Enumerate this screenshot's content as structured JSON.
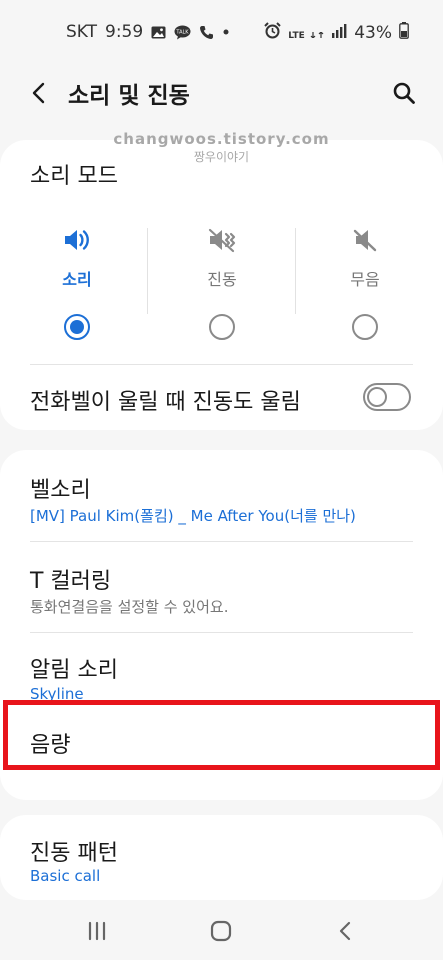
{
  "status_bar": {
    "carrier": "SKT",
    "time": "9:59",
    "left_icons": [
      "gallery-icon",
      "kakaotalk-icon",
      "phone-icon",
      "dot-icon"
    ],
    "right_icons": [
      "alarm-icon",
      "lte-icon",
      "signal-icon",
      "battery-icon"
    ],
    "lte_label": "LTE",
    "battery": "43%"
  },
  "app_bar": {
    "title": "소리 및 진동"
  },
  "watermark": {
    "line1": "changwoos.tistory.com",
    "line2": "짱우이야기"
  },
  "sound_mode": {
    "title": "소리 모드",
    "options": [
      {
        "label": "소리",
        "icon": "speaker-icon",
        "selected": true
      },
      {
        "label": "진동",
        "icon": "vibrate-icon",
        "selected": false
      },
      {
        "label": "무음",
        "icon": "mute-icon",
        "selected": false
      }
    ],
    "vibrate_when_ringing": {
      "label": "전화벨이 울릴 때 진동도 울림",
      "enabled": false
    }
  },
  "list": [
    {
      "title": "벨소리",
      "subtitle": "[MV] Paul Kim(폴킴) _ Me After You(너를 만나)"
    },
    {
      "title": "T 컬러링",
      "subtitle": "통화연결음을 설정할 수 있어요."
    },
    {
      "title": "알림 소리",
      "subtitle": "Skyline"
    },
    {
      "title": "음량",
      "subtitle": ""
    }
  ],
  "vibration_pattern": {
    "title": "진동 패턴",
    "subtitle": "Basic call"
  },
  "colors": {
    "accent": "#1c6fd6",
    "highlight": "#e8141b",
    "background": "#f6f6f6"
  },
  "nav_bar": {
    "buttons": [
      "recents-icon",
      "home-icon",
      "back-icon"
    ]
  }
}
